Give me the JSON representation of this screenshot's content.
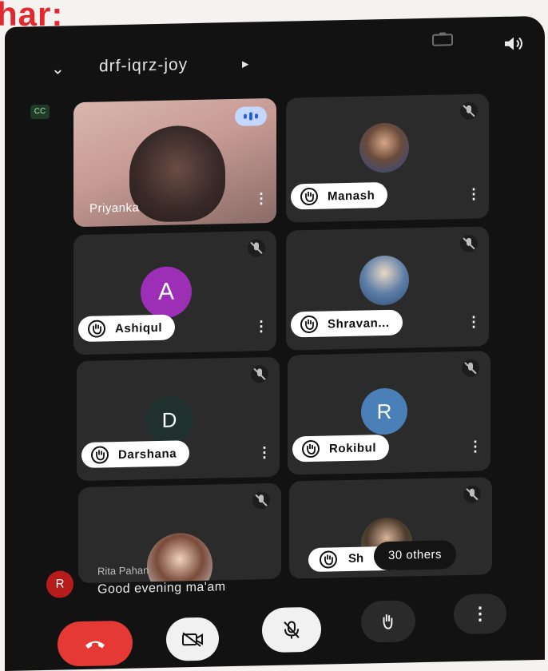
{
  "header_fragment": "har:",
  "meeting": {
    "code": "drf-iqrz-joy"
  },
  "tiles": [
    {
      "name": "Priyanka",
      "type": "video"
    },
    {
      "name": "Manash",
      "type": "photo"
    },
    {
      "name": "Ashiqul",
      "type": "initial",
      "initial": "A",
      "color": "#9c2fb5"
    },
    {
      "name": "Shravan...",
      "type": "photo"
    },
    {
      "name": "Darshana",
      "type": "initial",
      "initial": "D",
      "color": "#20302e"
    },
    {
      "name": "Rokibul",
      "type": "initial",
      "initial": "R",
      "color": "#4a7fb8"
    },
    {
      "name": "",
      "type": "photo"
    },
    {
      "name": "Sh",
      "type": "photo"
    }
  ],
  "chat": {
    "initial": "R",
    "sender": "Rita Pahan",
    "message": "Good evening ma'am"
  },
  "others_label": "30 others",
  "colors": {
    "end_call": "#e53935",
    "accent_audio": "#2a5fd6"
  },
  "icons": [
    "chevron-down-icon",
    "play-arrow-icon",
    "camera-flip-icon",
    "speaker-icon",
    "captions-icon",
    "audio-level-icon",
    "mic-off-icon",
    "more-vert-icon",
    "raise-hand-icon",
    "end-call-icon",
    "camera-off-icon"
  ]
}
